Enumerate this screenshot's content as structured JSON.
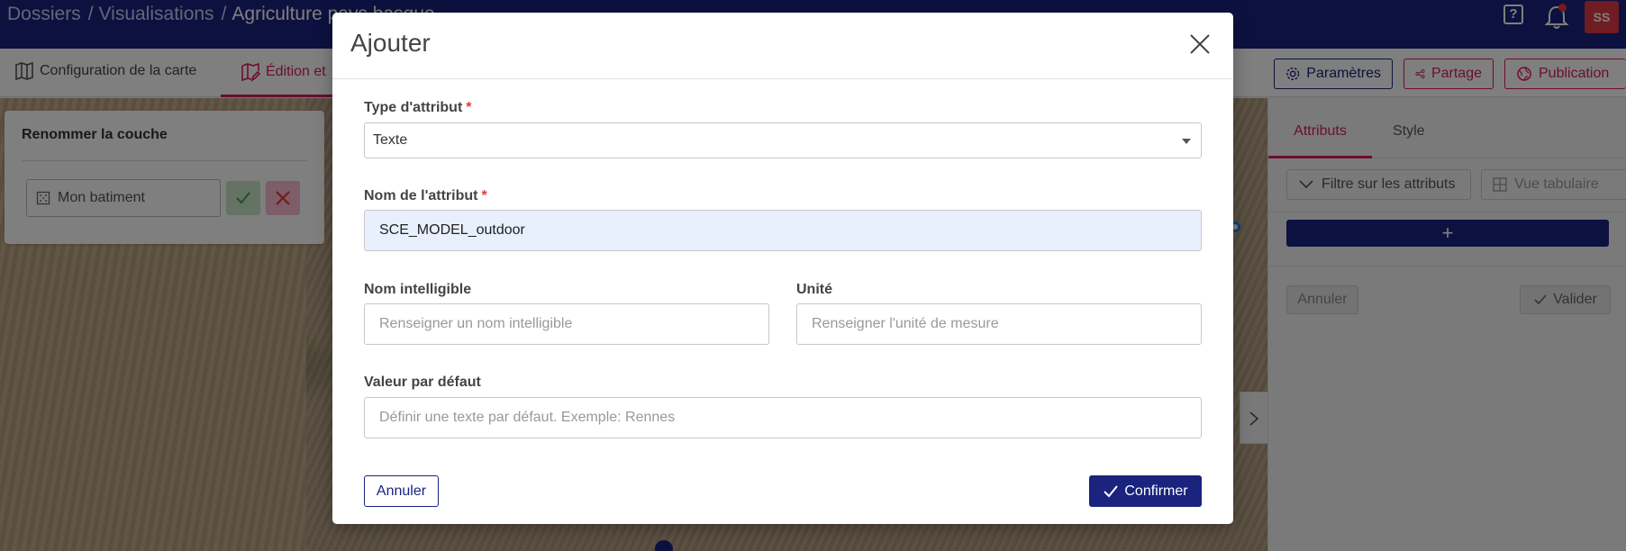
{
  "header": {
    "breadcrumb": [
      "Dossiers",
      "Visualisations",
      "Agriculture pays basque"
    ],
    "separator": "/",
    "help_label": "?",
    "avatar_initials": "SS",
    "brand_color": "#1a237e",
    "accent_color": "#d81b60"
  },
  "toolbar": {
    "tab_config": "Configuration de la carte",
    "tab_edit": "Édition et",
    "params_label": "Paramètres",
    "share_label": "Partage",
    "publish_label": "Publication"
  },
  "rename_panel": {
    "title": "Renommer la couche",
    "layer_name": "Mon batiment"
  },
  "side_panel": {
    "tab_attributes": "Attributs",
    "tab_style": "Style",
    "filter_label": "Filtre sur les attributs",
    "table_view_label": "Vue tabulaire",
    "add_label": "+",
    "cancel_label": "Annuler",
    "validate_label": "Valider"
  },
  "modal": {
    "title": "Ajouter",
    "type_label": "Type d'attribut",
    "type_value": "Texte",
    "name_label": "Nom de l'attribut",
    "name_value": "SCE_MODEL_outdoor",
    "required_mark": "*",
    "intelligible_label": "Nom intelligible",
    "intelligible_placeholder": "Renseigner un nom intelligible",
    "unit_label": "Unité",
    "unit_placeholder": "Renseigner l'unité de mesure",
    "default_label": "Valeur par défaut",
    "default_placeholder": "Définir une texte par défaut. Exemple: Rennes",
    "cancel_label": "Annuler",
    "confirm_label": "Confirmer"
  }
}
